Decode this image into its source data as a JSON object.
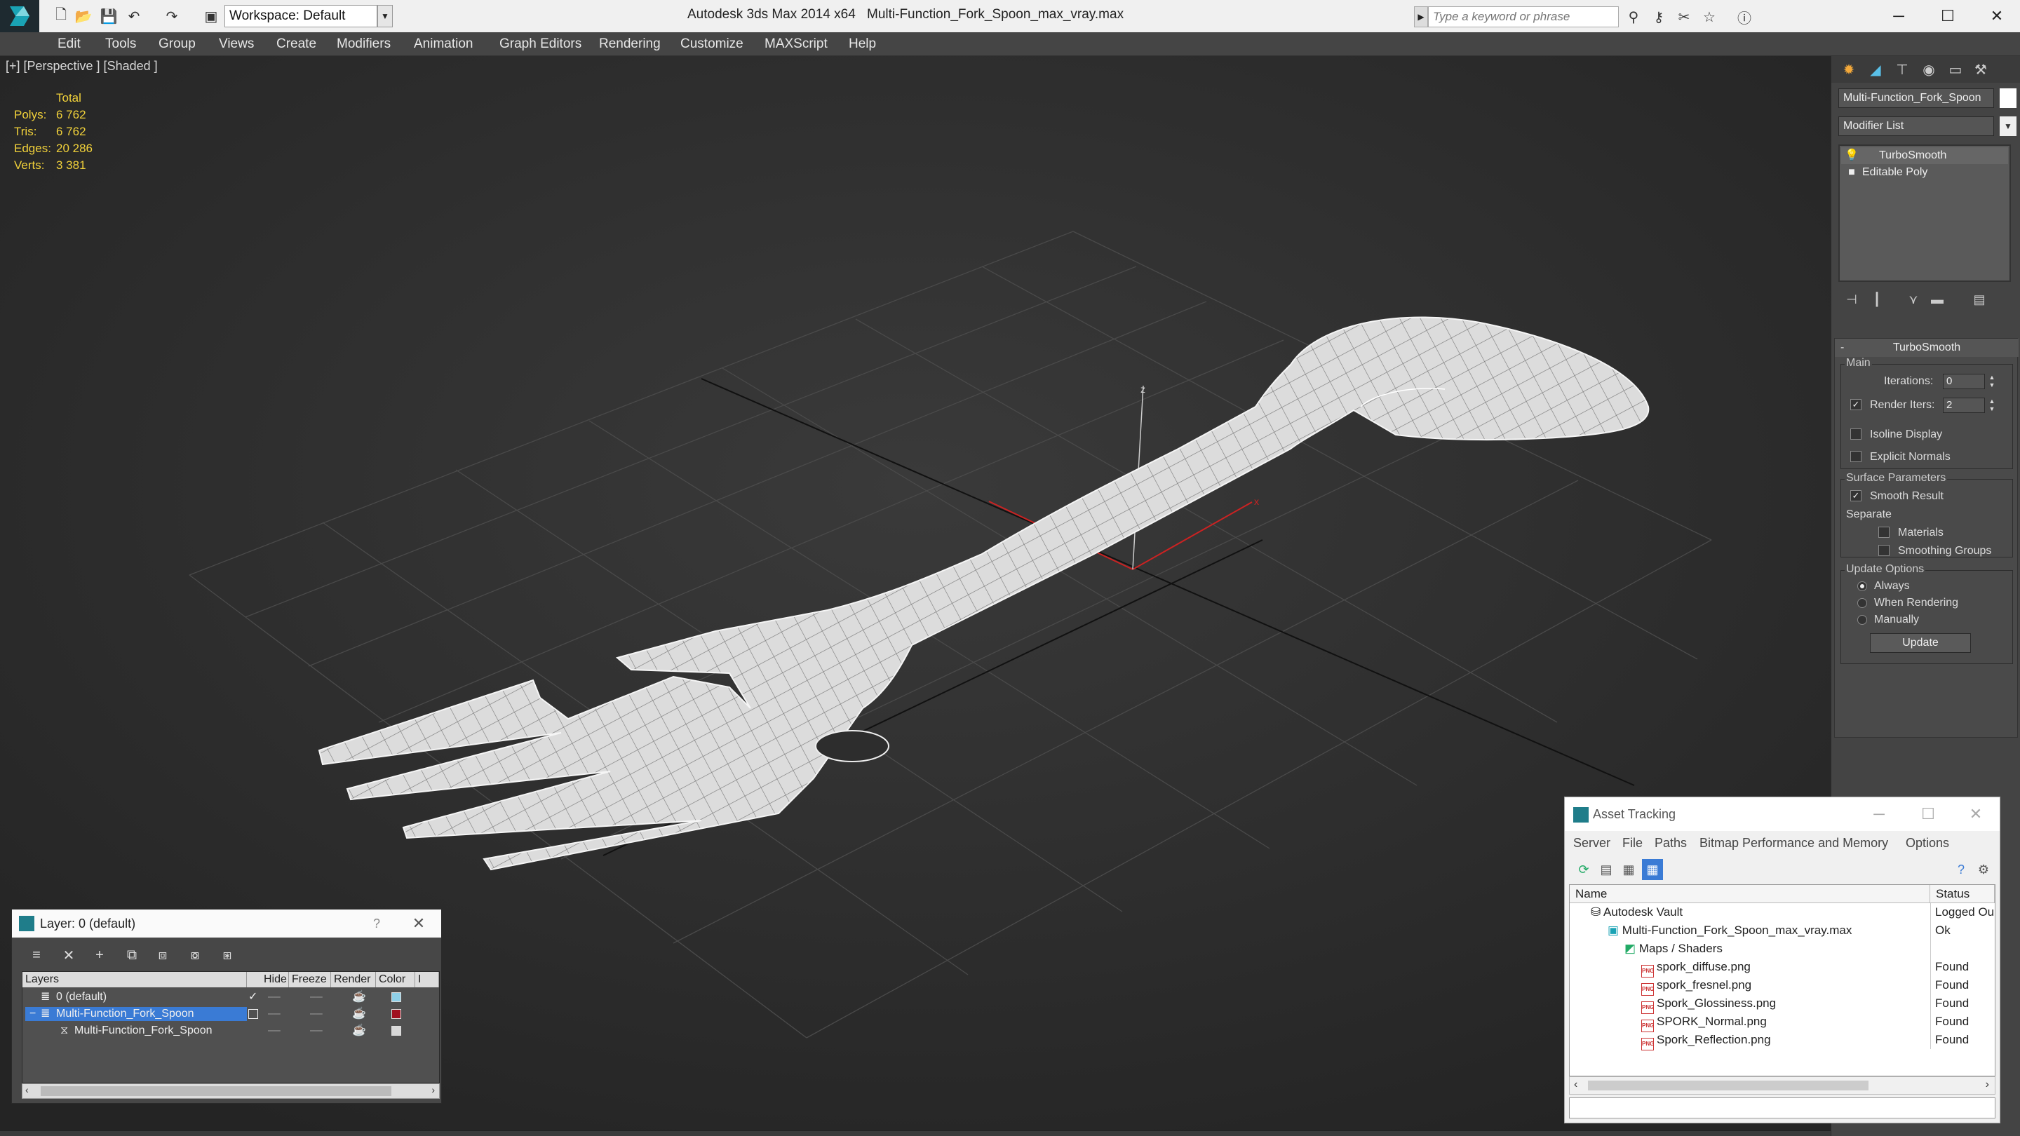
{
  "title_bar": {
    "workspace": "Workspace: Default",
    "app_title": "Autodesk 3ds Max  2014 x64",
    "doc_title": "Multi-Function_Fork_Spoon_max_vray.max",
    "search_placeholder": "Type a keyword or phrase"
  },
  "menu": [
    "Edit",
    "Tools",
    "Group",
    "Views",
    "Create",
    "Modifiers",
    "Animation",
    "Graph Editors",
    "Rendering",
    "Customize",
    "MAXScript",
    "Help"
  ],
  "viewport": {
    "label": "[+] [Perspective ] [Shaded ]",
    "stats_header": "Total",
    "stats": [
      {
        "key": "Polys:",
        "value": "6 762"
      },
      {
        "key": "Tris:",
        "value": "6 762"
      },
      {
        "key": "Edges:",
        "value": "20 286"
      },
      {
        "key": "Verts:",
        "value": "3 381"
      }
    ],
    "axis_x": "x",
    "axis_z": "z"
  },
  "command_panel": {
    "object_name": "Multi-Function_Fork_Spoon",
    "modifier_list": "Modifier List",
    "stack": [
      "TurboSmooth",
      "Editable Poly"
    ],
    "rollout_title": "TurboSmooth",
    "main_group": "Main",
    "iterations_label": "Iterations:",
    "iterations_value": "0",
    "render_iters_label": "Render Iters:",
    "render_iters_value": "2",
    "isoline_display": "Isoline Display",
    "explicit_normals": "Explicit Normals",
    "surface_params": "Surface Parameters",
    "smooth_result": "Smooth Result",
    "separate": "Separate",
    "materials": "Materials",
    "smoothing_groups": "Smoothing Groups",
    "update_options": "Update Options",
    "always": "Always",
    "when_rendering": "When Rendering",
    "manually": "Manually",
    "update_button": "Update"
  },
  "layer_window": {
    "title": "Layer: 0 (default)",
    "help": "?",
    "columns": [
      "Layers",
      "Hide",
      "Freeze",
      "Render",
      "Color",
      "I"
    ],
    "rows": [
      {
        "name": "0 (default)",
        "color": "#8fd0e8"
      },
      {
        "name": "Multi-Function_Fork_Spoon",
        "color": "#a01020"
      },
      {
        "name": "Multi-Function_Fork_Spoon",
        "color": "#d8d8d8"
      }
    ]
  },
  "asset_tracking": {
    "title": "Asset Tracking",
    "menu": [
      "Server",
      "File",
      "Paths",
      "Bitmap Performance and Memory",
      "Options"
    ],
    "columns": [
      "Name",
      "Status"
    ],
    "rows": [
      {
        "name": "Autodesk Vault",
        "status": "Logged Ou"
      },
      {
        "name": "Multi-Function_Fork_Spoon_max_vray.max",
        "status": "Ok"
      },
      {
        "name": "Maps / Shaders",
        "status": ""
      },
      {
        "name": "spork_diffuse.png",
        "status": "Found"
      },
      {
        "name": "spork_fresnel.png",
        "status": "Found"
      },
      {
        "name": "Spork_Glossiness.png",
        "status": "Found"
      },
      {
        "name": "SPORK_Normal.png",
        "status": "Found"
      },
      {
        "name": "Spork_Reflection.png",
        "status": "Found"
      }
    ]
  },
  "colors": {
    "viewport_bg": "#2b2b2b",
    "selection": "#3a7bd5",
    "stats": "#f2d23a"
  }
}
